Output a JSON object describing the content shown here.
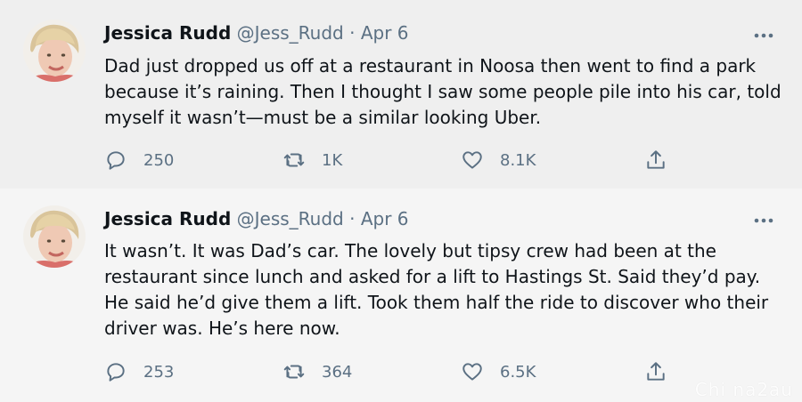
{
  "tweets": [
    {
      "author_name": "Jessica Rudd",
      "author_handle": "@Jess_Rudd",
      "separator": "·",
      "date": "Apr 6",
      "more_icon": "more-horizontal-icon",
      "text": "Dad just dropped us off at a restaurant in Noosa then went to find a park because it’s raining. Then I thought I saw some people pile into his car, told myself it wasn’t—must be a similar looking Uber.",
      "replies": "250",
      "retweets": "1K",
      "likes": "8.1K"
    },
    {
      "author_name": "Jessica Rudd",
      "author_handle": "@Jess_Rudd",
      "separator": "·",
      "date": "Apr 6",
      "more_icon": "more-horizontal-icon",
      "text": "It wasn’t. It was Dad’s car. The lovely but tipsy crew had been at the restaurant since lunch and asked for a lift to Hastings St. Said they’d pay. He said he’d give them a lift. Took them half the ride to discover who their driver was. He’s here now.",
      "replies": "253",
      "retweets": "364",
      "likes": "6.5K"
    }
  ],
  "watermark": "Chi na2au",
  "colors": {
    "text": "#0f1419",
    "secondary": "#5b7083",
    "background": "#efefef"
  }
}
